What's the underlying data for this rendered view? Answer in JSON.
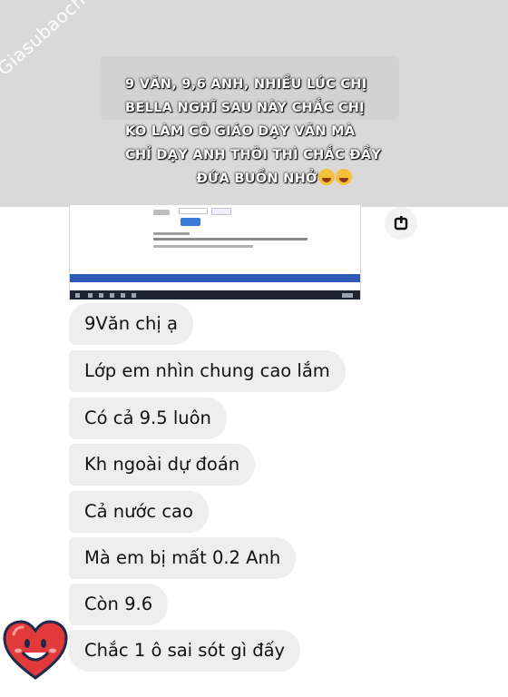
{
  "watermark": "Giasubaochau.net",
  "caption": {
    "lines": [
      "9 VĂN, 9,6 ANH, NHIỀU LÚC CHỊ",
      "BELLA  NGHĨ SAU NÀY CHẮC CHỊ",
      "KO LÀM CÔ GIÁO DẠY VĂN MÀ",
      "CHỈ DẠY ANH THÔI THÌ CHẮC ĐẦY",
      "ĐỨA BUỒN NHỞ"
    ],
    "emoji": [
      "laughing-face-icon",
      "laughing-face-icon"
    ]
  },
  "shared_screenshot": {
    "description_icon": "webpage-screenshot"
  },
  "power_icon": "power-icon",
  "messages": [
    {
      "text": "9Văn chị ạ"
    },
    {
      "text": "Lớp em nhìn chung cao lắm"
    },
    {
      "text": "Có cả 9.5 luôn"
    },
    {
      "text": "Kh ngoài dự đoán"
    },
    {
      "text": "Cả nước cao"
    },
    {
      "text": "Mà em bị mất 0.2 Anh"
    },
    {
      "text": "Còn 9.6"
    },
    {
      "text": "Chắc 1 ô sai sót gì đấy"
    }
  ],
  "sticker": "smiling-heart-icon",
  "colors": {
    "overlay": "#d9d9d9",
    "bubble": "#eeeeee",
    "heart": "#e23a3a"
  }
}
